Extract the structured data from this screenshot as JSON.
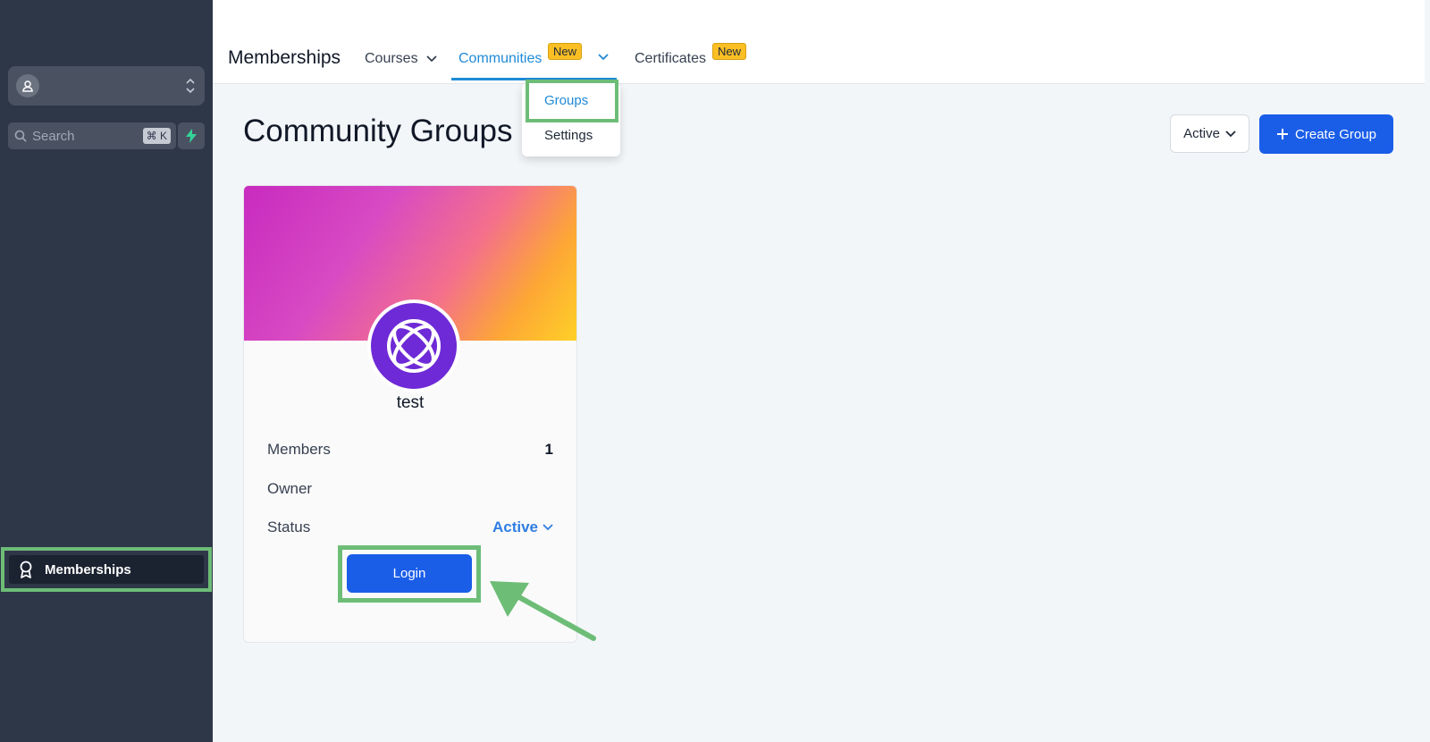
{
  "sidebar": {
    "search": {
      "placeholder": "Search",
      "shortcut": "⌘ K"
    },
    "nav_items": [
      {
        "label": "Memberships",
        "icon": "award-ribbon-icon"
      }
    ]
  },
  "topbar": {
    "title": "Memberships",
    "tabs": [
      {
        "label": "Courses"
      },
      {
        "label": "Communities",
        "badge": "New",
        "active": true
      },
      {
        "label": "Certificates",
        "badge": "New"
      }
    ]
  },
  "dropdown": {
    "items": [
      {
        "label": "Groups"
      },
      {
        "label": "Settings"
      }
    ]
  },
  "main": {
    "title": "Community Groups",
    "filter": {
      "selected": "Active"
    },
    "create_button": "Create Group"
  },
  "card": {
    "name": "test",
    "rows": [
      {
        "label": "Members",
        "value": "1"
      },
      {
        "label": "Owner",
        "value": ""
      },
      {
        "label": "Status",
        "value": "Active"
      }
    ],
    "login_button": "Login"
  },
  "colors": {
    "sidebar_bg": "#2e3748",
    "accent_blue": "#1a5ee8",
    "link_blue": "#1f8ad6",
    "badge_yellow": "#fbbf24",
    "annotation_green": "#6dbd77"
  }
}
